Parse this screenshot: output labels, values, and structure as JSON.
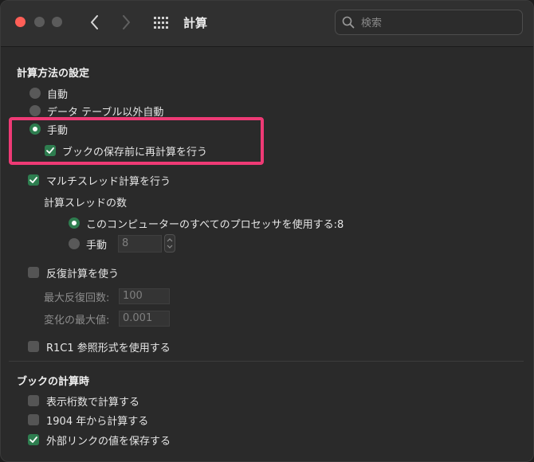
{
  "window": {
    "title": "計算",
    "search_placeholder": "検索"
  },
  "calc_settings": {
    "heading": "計算方法の設定",
    "options": {
      "auto": "自動",
      "auto_except_tables": "データ テーブル以外自動",
      "manual": "手動"
    },
    "selected": "手動",
    "recalc_before_save": "ブックの保存前に再計算を行う",
    "recalc_before_save_checked": true,
    "multithread": "マルチスレッド計算を行う",
    "multithread_checked": true,
    "threads_heading": "計算スレッドの数",
    "threads_use_all": "このコンピューターのすべてのプロセッサを使用する:8",
    "threads_manual": "手動",
    "threads_manual_value": "8",
    "iterative": "反復計算を使う",
    "iterative_checked": false,
    "max_iterations_label": "最大反復回数:",
    "max_iterations_value": "100",
    "max_change_label": "変化の最大値:",
    "max_change_value": "0.001",
    "r1c1": "R1C1 参照形式を使用する",
    "r1c1_checked": false
  },
  "workbook_calc": {
    "heading": "ブックの計算時",
    "precision_as_displayed": "表示桁数で計算する",
    "precision_as_displayed_checked": false,
    "date_1904": "1904 年から計算する",
    "date_1904_checked": false,
    "save_external_links": "外部リンクの値を保存する",
    "save_external_links_checked": true
  },
  "colors": {
    "accent_green": "#2e7d4f",
    "highlight_pink": "#ee3a75",
    "close_red": "#ff5f57"
  }
}
